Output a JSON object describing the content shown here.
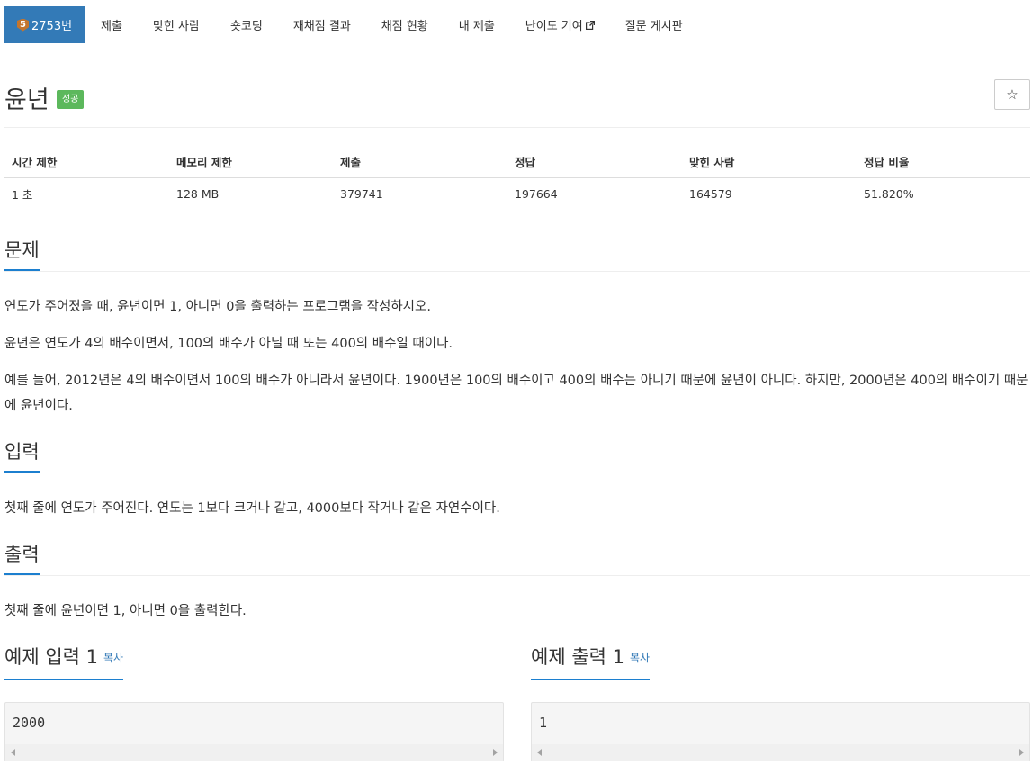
{
  "tabs": [
    {
      "label": "2753번",
      "tier": "5",
      "active": true
    },
    {
      "label": "제출"
    },
    {
      "label": "맞힌 사람"
    },
    {
      "label": "숏코딩"
    },
    {
      "label": "재채점 결과"
    },
    {
      "label": "채점 현황"
    },
    {
      "label": "내 제출"
    },
    {
      "label": "난이도 기여",
      "external": true
    },
    {
      "label": "질문 게시판"
    }
  ],
  "problem": {
    "title": "윤년",
    "badge": "성공",
    "star": "☆"
  },
  "info_table": {
    "headers": [
      "시간 제한",
      "메모리 제한",
      "제출",
      "정답",
      "맞힌 사람",
      "정답 비율"
    ],
    "values": [
      "1 초",
      "128 MB",
      "379741",
      "197664",
      "164579",
      "51.820%"
    ]
  },
  "sections": {
    "problem_heading": "문제",
    "problem_p1": "연도가 주어졌을 때, 윤년이면 1, 아니면 0을 출력하는 프로그램을 작성하시오.",
    "problem_p2": "윤년은 연도가 4의 배수이면서, 100의 배수가 아닐 때 또는 400의 배수일 때이다.",
    "problem_p3": "예를 들어, 2012년은 4의 배수이면서 100의 배수가 아니라서 윤년이다. 1900년은 100의 배수이고 400의 배수는 아니기 때문에 윤년이 아니다. 하지만, 2000년은 400의 배수이기 때문에 윤년이다.",
    "input_heading": "입력",
    "input_text": "첫째 줄에 연도가 주어진다. 연도는 1보다 크거나 같고, 4000보다 작거나 같은 자연수이다.",
    "output_heading": "출력",
    "output_text": "첫째 줄에 윤년이면 1, 아니면 0을 출력한다."
  },
  "samples": {
    "input_heading": "예제 입력 1",
    "input_copy": "복사",
    "input_value": "2000",
    "output_heading": "예제 출력 1",
    "output_copy": "복사",
    "output_value": "1"
  },
  "colors": {
    "accent": "#337ab7",
    "success_badge": "#5cb85c",
    "underline": "#1c7fcf",
    "tier_bronze": "#c4752d"
  }
}
